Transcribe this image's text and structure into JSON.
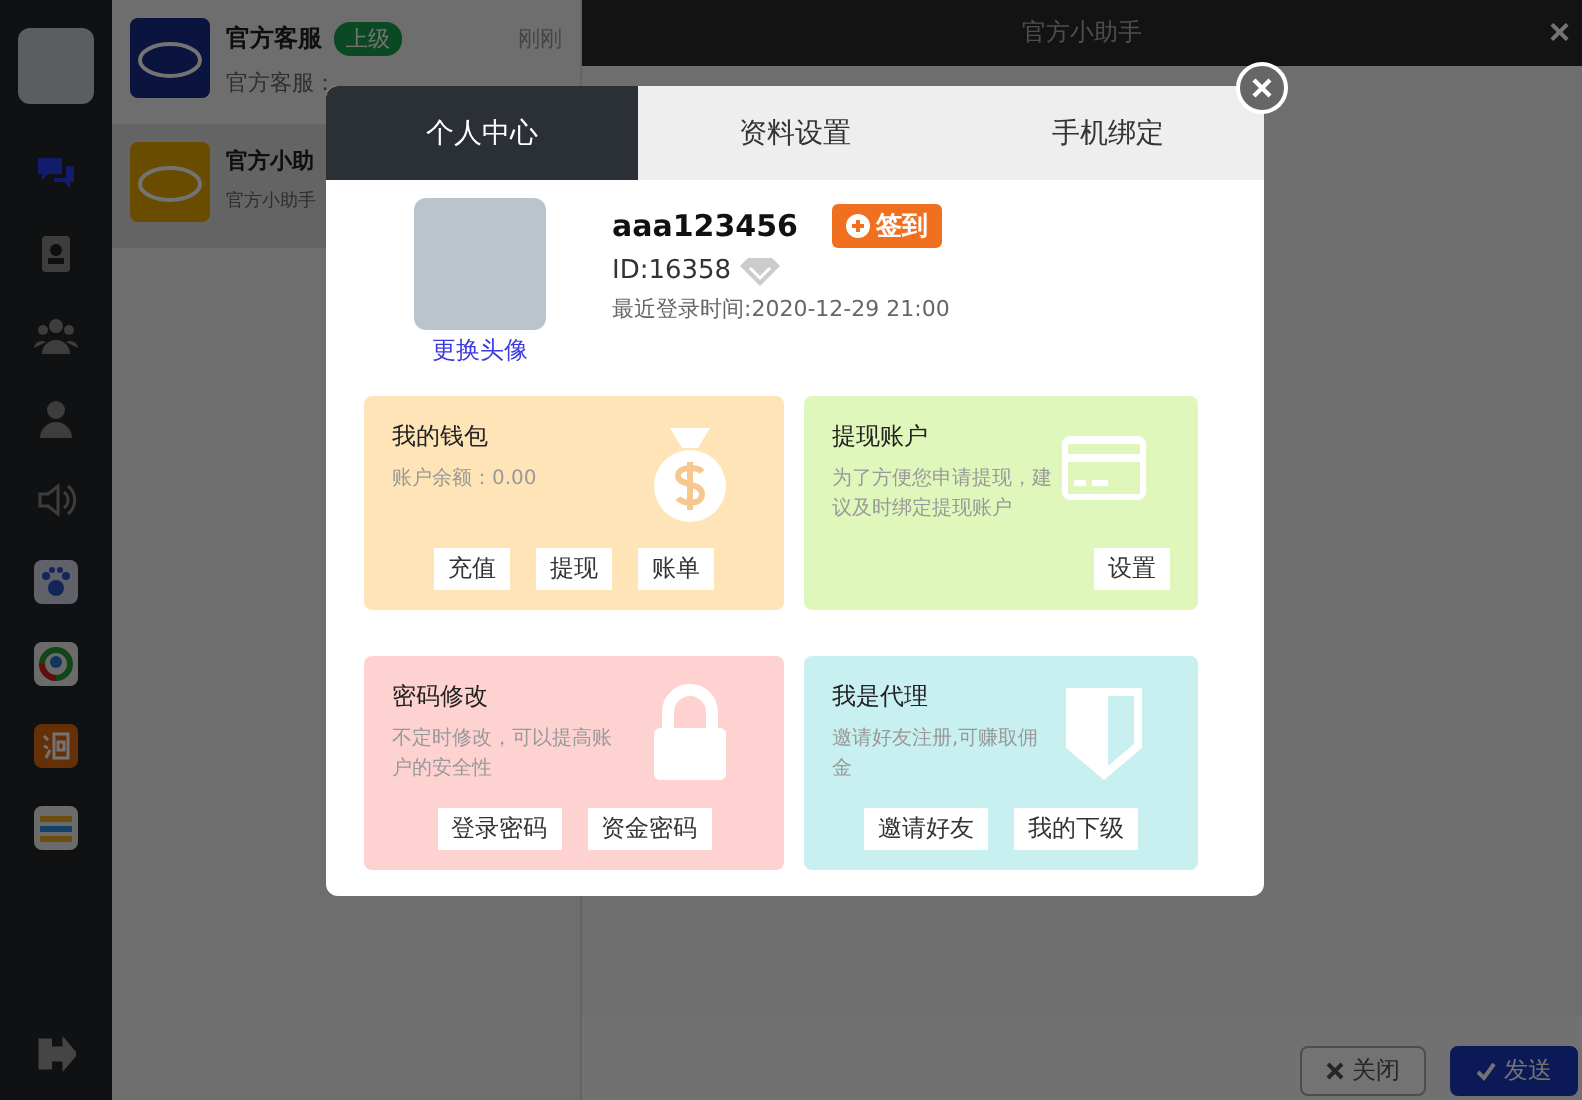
{
  "chat_list": [
    {
      "name": "官方客服",
      "badge": "上级",
      "time": "刚刚",
      "preview": "官方客服："
    },
    {
      "name": "官方小助",
      "preview": "官方小助手"
    }
  ],
  "window": {
    "title": "官方小助手",
    "close": "×"
  },
  "footer_buttons": [
    {
      "label": "关闭",
      "kind": "close"
    },
    {
      "label": "发送",
      "kind": "send"
    }
  ],
  "dialog": {
    "tabs": [
      {
        "label": "个人中心",
        "selected": true
      },
      {
        "label": "资料设置",
        "selected": false
      },
      {
        "label": "手机绑定",
        "selected": false
      }
    ],
    "profile": {
      "change_avatar": "更换头像",
      "username": "aaa123456",
      "checkin": "签到",
      "id": "ID:16358",
      "last_login": "最近登录时间:2020-12-29 21:00"
    },
    "cards": [
      {
        "title": "我的钱包",
        "text": "账户余额：0.00",
        "color": "#ffe4b8",
        "buttons": [
          "充值",
          "提现",
          "账单"
        ]
      },
      {
        "title": "提现账户",
        "text": "为了方便您申请提现，建议及时绑定提现账户",
        "color": "#e0f7bb",
        "buttons": [
          "设置"
        ]
      },
      {
        "title": "密码修改",
        "text": "不定时修改，可以提高账户的安全性",
        "color": "#ffd2d2",
        "buttons": [
          "登录密码",
          "资金密码"
        ]
      },
      {
        "title": "我是代理",
        "text": "邀请好友注册,可赚取佣金",
        "color": "#c9f0f0",
        "buttons": [
          "邀请好友",
          "我的下级"
        ]
      }
    ]
  }
}
